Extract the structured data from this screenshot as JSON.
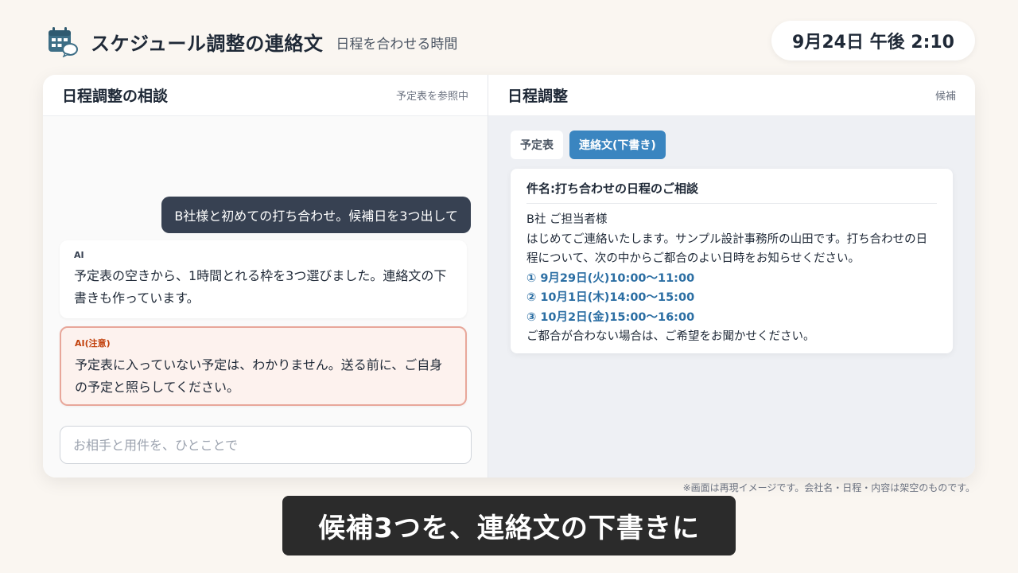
{
  "header": {
    "title": "スケジュール調整の連絡文",
    "subtitle": "日程を合わせる時間",
    "clock": "9月24日 午後 2:10",
    "icon": "calendar-chat-icon"
  },
  "left_panel": {
    "title": "日程調整の相談",
    "meta": "予定表を参照中",
    "messages": {
      "user": "B社様と初めての打ち合わせ。候補日を3つ出して",
      "ai_label": "AI",
      "ai_text": "予定表の空きから、1時間とれる枠を3つ選びました。連絡文の下書きも作っています。",
      "warn_label": "AI(注意)",
      "warn_text": "予定表に入っていない予定は、わかりません。送る前に、ご自身の予定と照らしてください。"
    },
    "input": {
      "placeholder": "お相手と用件を、ひとことで",
      "value": ""
    }
  },
  "right_panel": {
    "title": "日程調整",
    "meta": "候補",
    "tabs": [
      {
        "label": "予定表"
      },
      {
        "label": "連絡文(下書き)"
      }
    ],
    "draft": {
      "subject": "件名:打ち合わせの日程のご相談",
      "greeting": "B社 ご担当者様",
      "body1": "はじめてご連絡いたします。サンプル設計事務所の山田です。打ち合わせの日程について、次の中からご都合のよい日時をお知らせください。",
      "slots": [
        "① 9月29日(火)10:00〜11:00",
        "② 10月1日(木)14:00〜15:00",
        "③ 10月2日(金)15:00〜16:00"
      ],
      "closing": "ご都合が合わない場合は、ご希望をお聞かせください。"
    }
  },
  "footer": {
    "disclaimer": "※画面は再現イメージです。会社名・日程・内容は架空のものです。",
    "caption": "候補3つを、連絡文の下書きに"
  },
  "colors": {
    "accent": "#3a85c0",
    "user_bubble": "#374152",
    "warn_border": "#e8a79a",
    "slot_text": "#2b6ea3"
  }
}
